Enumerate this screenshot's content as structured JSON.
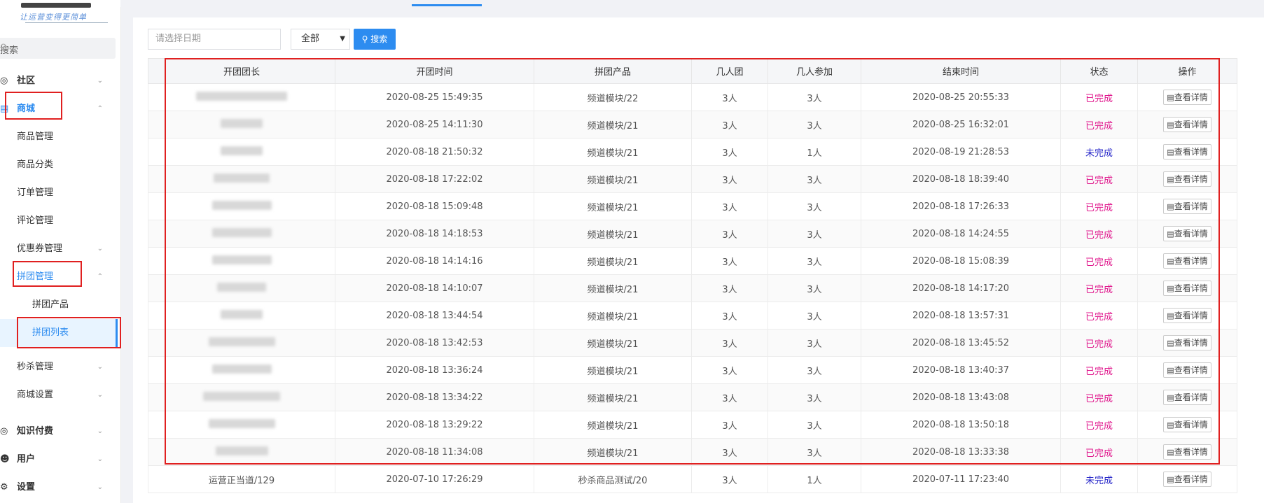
{
  "sidebar": {
    "logo_subtitle": "让运营变得更简单",
    "search_label": "搜索",
    "items": [
      {
        "label": "社区",
        "icon": "community-icon"
      },
      {
        "label": "商城",
        "icon": "mall-icon"
      },
      {
        "label": "商品管理"
      },
      {
        "label": "商品分类"
      },
      {
        "label": "订单管理"
      },
      {
        "label": "评论管理"
      },
      {
        "label": "优惠券管理"
      },
      {
        "label": "拼团管理"
      },
      {
        "label": "拼团产品"
      },
      {
        "label": "拼团列表"
      },
      {
        "label": "秒杀管理"
      },
      {
        "label": "商城设置"
      },
      {
        "label": "知识付费",
        "icon": "bulb-icon"
      },
      {
        "label": "用户",
        "icon": "user-icon"
      },
      {
        "label": "设置",
        "icon": "gear-icon"
      }
    ]
  },
  "filters": {
    "date_placeholder": "请选择日期",
    "status_selected": "全部",
    "search_button": "搜索"
  },
  "table": {
    "headers": [
      "开团团长",
      "开团时间",
      "拼团产品",
      "几人团",
      "几人参加",
      "结束时间",
      "状态",
      "操作"
    ],
    "action_label": "查看详情",
    "rows": [
      {
        "leader": "",
        "start": "2020-08-25 15:49:35",
        "product": "频道模块/22",
        "size": "3人",
        "joined": "3人",
        "end": "2020-08-25 20:55:33",
        "status": "已完成"
      },
      {
        "leader": "",
        "start": "2020-08-25 14:11:30",
        "product": "频道模块/21",
        "size": "3人",
        "joined": "3人",
        "end": "2020-08-25 16:32:01",
        "status": "已完成"
      },
      {
        "leader": "",
        "start": "2020-08-18 21:50:32",
        "product": "频道模块/21",
        "size": "3人",
        "joined": "1人",
        "end": "2020-08-19 21:28:53",
        "status": "未完成"
      },
      {
        "leader": "",
        "start": "2020-08-18 17:22:02",
        "product": "频道模块/21",
        "size": "3人",
        "joined": "3人",
        "end": "2020-08-18 18:39:40",
        "status": "已完成"
      },
      {
        "leader": "",
        "start": "2020-08-18 15:09:48",
        "product": "频道模块/21",
        "size": "3人",
        "joined": "3人",
        "end": "2020-08-18 17:26:33",
        "status": "已完成"
      },
      {
        "leader": "",
        "start": "2020-08-18 14:18:53",
        "product": "频道模块/21",
        "size": "3人",
        "joined": "3人",
        "end": "2020-08-18 14:24:55",
        "status": "已完成"
      },
      {
        "leader": "",
        "start": "2020-08-18 14:14:16",
        "product": "频道模块/21",
        "size": "3人",
        "joined": "3人",
        "end": "2020-08-18 15:08:39",
        "status": "已完成"
      },
      {
        "leader": "",
        "start": "2020-08-18 14:10:07",
        "product": "频道模块/21",
        "size": "3人",
        "joined": "3人",
        "end": "2020-08-18 14:17:20",
        "status": "已完成"
      },
      {
        "leader": "",
        "start": "2020-08-18 13:44:54",
        "product": "频道模块/21",
        "size": "3人",
        "joined": "3人",
        "end": "2020-08-18 13:57:31",
        "status": "已完成"
      },
      {
        "leader": "",
        "start": "2020-08-18 13:42:53",
        "product": "频道模块/21",
        "size": "3人",
        "joined": "3人",
        "end": "2020-08-18 13:45:52",
        "status": "已完成"
      },
      {
        "leader": "",
        "start": "2020-08-18 13:36:24",
        "product": "频道模块/21",
        "size": "3人",
        "joined": "3人",
        "end": "2020-08-18 13:40:37",
        "status": "已完成"
      },
      {
        "leader": "",
        "start": "2020-08-18 13:34:22",
        "product": "频道模块/21",
        "size": "3人",
        "joined": "3人",
        "end": "2020-08-18 13:43:08",
        "status": "已完成"
      },
      {
        "leader": "",
        "start": "2020-08-18 13:29:22",
        "product": "频道模块/21",
        "size": "3人",
        "joined": "3人",
        "end": "2020-08-18 13:50:18",
        "status": "已完成"
      },
      {
        "leader": "",
        "start": "2020-08-18 11:34:08",
        "product": "频道模块/21",
        "size": "3人",
        "joined": "3人",
        "end": "2020-08-18 13:33:38",
        "status": "已完成"
      },
      {
        "leader": "运营正当道/129",
        "start": "2020-07-10 17:26:29",
        "product": "秒杀商品测试/20",
        "size": "3人",
        "joined": "1人",
        "end": "2020-07-11 17:23:40",
        "status": "未完成"
      }
    ]
  },
  "colors": {
    "accent": "#2d8cf0",
    "done": "#e0168c",
    "undone": "#2424c8",
    "highlight": "#e02020"
  }
}
